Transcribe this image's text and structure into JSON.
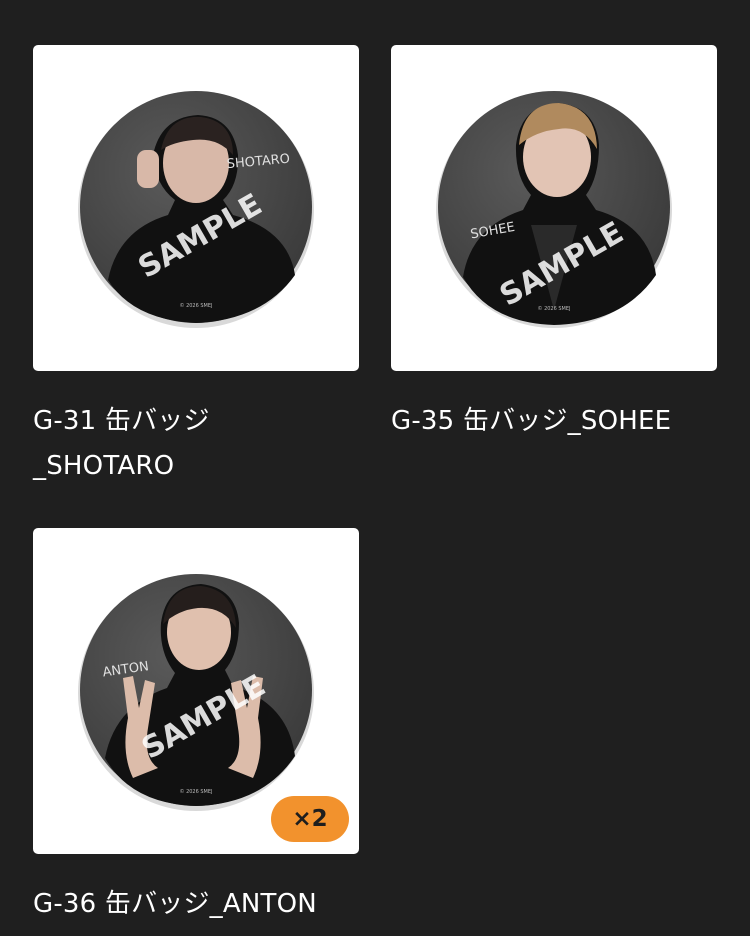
{
  "items": [
    {
      "title": "G-31 缶バッジ\n_SHOTARO",
      "signature": "SHOTARO",
      "watermark": "SAMPLE",
      "copyright": "© 2026 SMEJ",
      "quantity": null
    },
    {
      "title": "G-35 缶バッジ_SOHEE",
      "signature": "SOHEE",
      "watermark": "SAMPLE",
      "copyright": "© 2026 SMEJ",
      "quantity": null
    },
    {
      "title": "G-36 缶バッジ_ANTON",
      "signature": "ANTON",
      "watermark": "SAMPLE",
      "copyright": "© 2026 SMEJ",
      "quantity": "×2"
    }
  ],
  "colors": {
    "background": "#1f1f1f",
    "card": "#ffffff",
    "badge": "#4a4a4a",
    "quantity_badge": "#f2922d"
  }
}
